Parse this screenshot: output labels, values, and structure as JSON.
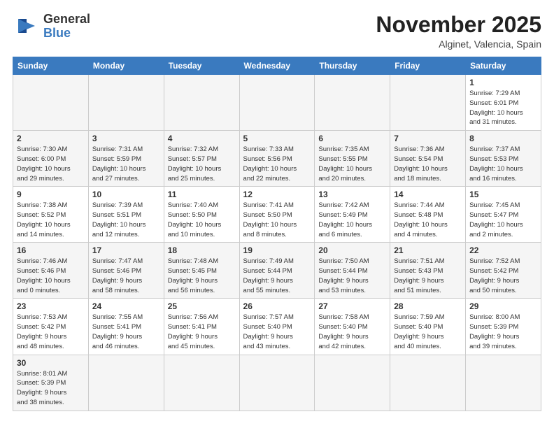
{
  "header": {
    "logo_line1": "General",
    "logo_line2": "Blue",
    "month_title": "November 2025",
    "location": "Alginet, Valencia, Spain"
  },
  "days_of_week": [
    "Sunday",
    "Monday",
    "Tuesday",
    "Wednesday",
    "Thursday",
    "Friday",
    "Saturday"
  ],
  "weeks": [
    [
      {
        "day": "",
        "info": ""
      },
      {
        "day": "",
        "info": ""
      },
      {
        "day": "",
        "info": ""
      },
      {
        "day": "",
        "info": ""
      },
      {
        "day": "",
        "info": ""
      },
      {
        "day": "",
        "info": ""
      },
      {
        "day": "1",
        "info": "Sunrise: 7:29 AM\nSunset: 6:01 PM\nDaylight: 10 hours\nand 31 minutes."
      }
    ],
    [
      {
        "day": "2",
        "info": "Sunrise: 7:30 AM\nSunset: 6:00 PM\nDaylight: 10 hours\nand 29 minutes."
      },
      {
        "day": "3",
        "info": "Sunrise: 7:31 AM\nSunset: 5:59 PM\nDaylight: 10 hours\nand 27 minutes."
      },
      {
        "day": "4",
        "info": "Sunrise: 7:32 AM\nSunset: 5:57 PM\nDaylight: 10 hours\nand 25 minutes."
      },
      {
        "day": "5",
        "info": "Sunrise: 7:33 AM\nSunset: 5:56 PM\nDaylight: 10 hours\nand 22 minutes."
      },
      {
        "day": "6",
        "info": "Sunrise: 7:35 AM\nSunset: 5:55 PM\nDaylight: 10 hours\nand 20 minutes."
      },
      {
        "day": "7",
        "info": "Sunrise: 7:36 AM\nSunset: 5:54 PM\nDaylight: 10 hours\nand 18 minutes."
      },
      {
        "day": "8",
        "info": "Sunrise: 7:37 AM\nSunset: 5:53 PM\nDaylight: 10 hours\nand 16 minutes."
      }
    ],
    [
      {
        "day": "9",
        "info": "Sunrise: 7:38 AM\nSunset: 5:52 PM\nDaylight: 10 hours\nand 14 minutes."
      },
      {
        "day": "10",
        "info": "Sunrise: 7:39 AM\nSunset: 5:51 PM\nDaylight: 10 hours\nand 12 minutes."
      },
      {
        "day": "11",
        "info": "Sunrise: 7:40 AM\nSunset: 5:50 PM\nDaylight: 10 hours\nand 10 minutes."
      },
      {
        "day": "12",
        "info": "Sunrise: 7:41 AM\nSunset: 5:50 PM\nDaylight: 10 hours\nand 8 minutes."
      },
      {
        "day": "13",
        "info": "Sunrise: 7:42 AM\nSunset: 5:49 PM\nDaylight: 10 hours\nand 6 minutes."
      },
      {
        "day": "14",
        "info": "Sunrise: 7:44 AM\nSunset: 5:48 PM\nDaylight: 10 hours\nand 4 minutes."
      },
      {
        "day": "15",
        "info": "Sunrise: 7:45 AM\nSunset: 5:47 PM\nDaylight: 10 hours\nand 2 minutes."
      }
    ],
    [
      {
        "day": "16",
        "info": "Sunrise: 7:46 AM\nSunset: 5:46 PM\nDaylight: 10 hours\nand 0 minutes."
      },
      {
        "day": "17",
        "info": "Sunrise: 7:47 AM\nSunset: 5:46 PM\nDaylight: 9 hours\nand 58 minutes."
      },
      {
        "day": "18",
        "info": "Sunrise: 7:48 AM\nSunset: 5:45 PM\nDaylight: 9 hours\nand 56 minutes."
      },
      {
        "day": "19",
        "info": "Sunrise: 7:49 AM\nSunset: 5:44 PM\nDaylight: 9 hours\nand 55 minutes."
      },
      {
        "day": "20",
        "info": "Sunrise: 7:50 AM\nSunset: 5:44 PM\nDaylight: 9 hours\nand 53 minutes."
      },
      {
        "day": "21",
        "info": "Sunrise: 7:51 AM\nSunset: 5:43 PM\nDaylight: 9 hours\nand 51 minutes."
      },
      {
        "day": "22",
        "info": "Sunrise: 7:52 AM\nSunset: 5:42 PM\nDaylight: 9 hours\nand 50 minutes."
      }
    ],
    [
      {
        "day": "23",
        "info": "Sunrise: 7:53 AM\nSunset: 5:42 PM\nDaylight: 9 hours\nand 48 minutes."
      },
      {
        "day": "24",
        "info": "Sunrise: 7:55 AM\nSunset: 5:41 PM\nDaylight: 9 hours\nand 46 minutes."
      },
      {
        "day": "25",
        "info": "Sunrise: 7:56 AM\nSunset: 5:41 PM\nDaylight: 9 hours\nand 45 minutes."
      },
      {
        "day": "26",
        "info": "Sunrise: 7:57 AM\nSunset: 5:40 PM\nDaylight: 9 hours\nand 43 minutes."
      },
      {
        "day": "27",
        "info": "Sunrise: 7:58 AM\nSunset: 5:40 PM\nDaylight: 9 hours\nand 42 minutes."
      },
      {
        "day": "28",
        "info": "Sunrise: 7:59 AM\nSunset: 5:40 PM\nDaylight: 9 hours\nand 40 minutes."
      },
      {
        "day": "29",
        "info": "Sunrise: 8:00 AM\nSunset: 5:39 PM\nDaylight: 9 hours\nand 39 minutes."
      }
    ],
    [
      {
        "day": "30",
        "info": "Sunrise: 8:01 AM\nSunset: 5:39 PM\nDaylight: 9 hours\nand 38 minutes."
      },
      {
        "day": "",
        "info": ""
      },
      {
        "day": "",
        "info": ""
      },
      {
        "day": "",
        "info": ""
      },
      {
        "day": "",
        "info": ""
      },
      {
        "day": "",
        "info": ""
      },
      {
        "day": "",
        "info": ""
      }
    ]
  ]
}
